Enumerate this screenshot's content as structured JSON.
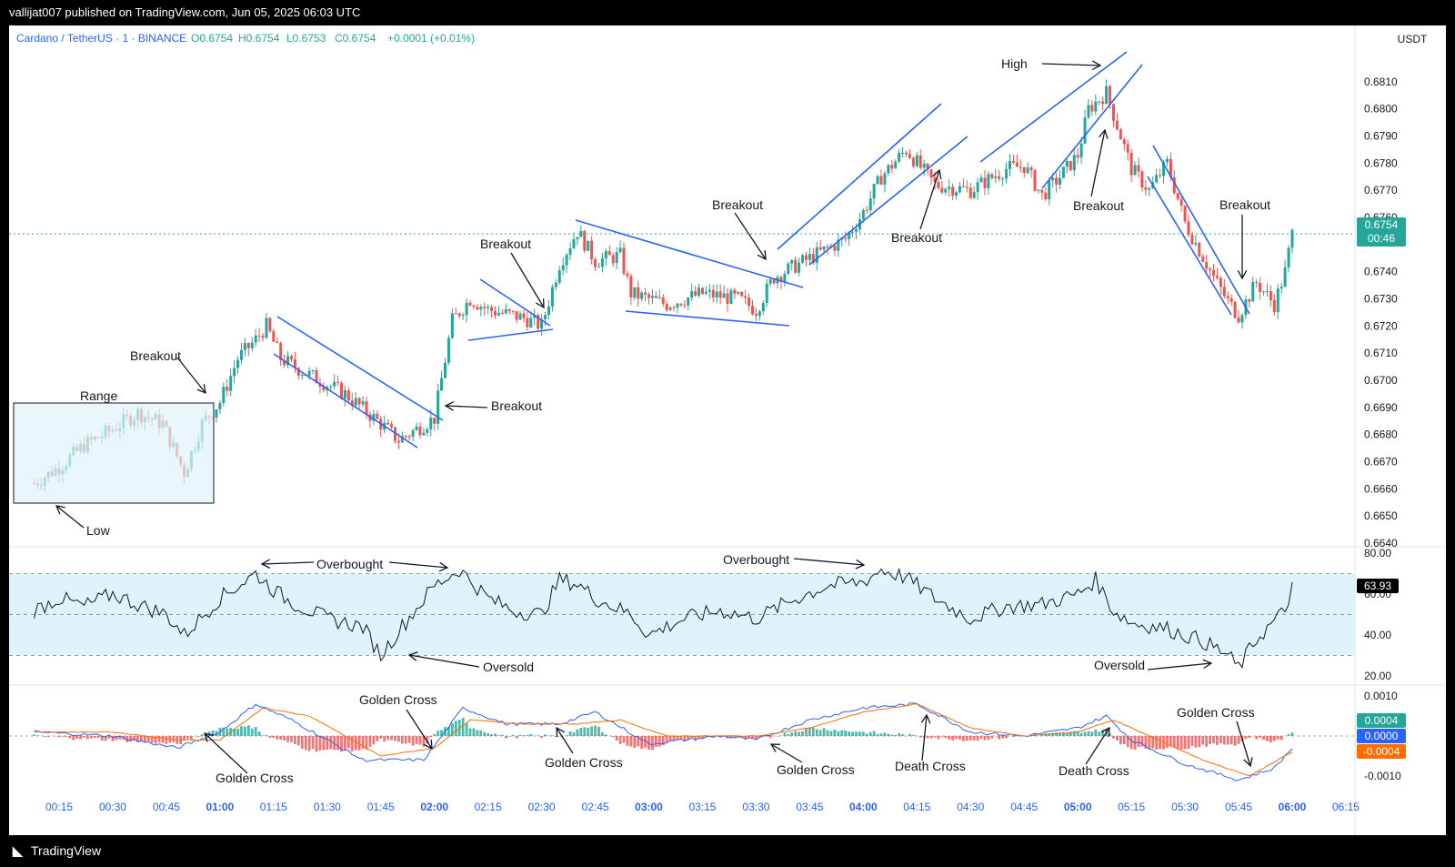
{
  "header": {
    "published": "vallijat007 published on TradingView.com, Jun 05, 2025 06:03 UTC"
  },
  "footer": {
    "brand": "TradingView"
  },
  "chart": {
    "symbol_line": "Cardano / TetherUS · 1 · BINANCE",
    "ohlc": {
      "o": "O0.6754",
      "h": "H0.6754",
      "l": "L0.6753",
      "c": "C0.6754",
      "chg": "+0.0001 (+0.01%)"
    },
    "currency": "USDT",
    "last_price_label": "0.6754",
    "countdown": "00:46",
    "rsi_value_label": "63.93",
    "macd_labels": {
      "hist": "0.0004",
      "macd": "0.0000",
      "signal": "-0.0004"
    },
    "colors": {
      "up": "#26a69a",
      "down": "#ef5350",
      "trend": "#2962ff",
      "macd": "#2962ff",
      "signal": "#ff6d00",
      "rsi_band": "#e0f3fa"
    }
  },
  "annotations": {
    "range": "Range",
    "low": "Low",
    "breakout_1": "Breakout",
    "breakout_2": "Breakout",
    "breakout_3": "Breakout",
    "breakout_4": "Breakout",
    "breakout_5": "Breakout",
    "breakout_6": "Breakout",
    "breakout_7": "Breakout",
    "high": "High",
    "overbought_1": "Overbought",
    "overbought_2": "Overbought",
    "oversold_1": "Oversold",
    "oversold_2": "Oversold",
    "golden_1": "Golden Cross",
    "golden_2": "Golden Cross",
    "golden_3": "Golden Cross",
    "golden_4": "Golden Cross",
    "golden_5": "Golden Cross",
    "death_1": "Death Cross",
    "death_2": "Death Cross"
  },
  "chart_data": [
    {
      "type": "candlestick",
      "title": "Cardano / TetherUS · 1 · BINANCE",
      "x": [
        "00:15",
        "00:30",
        "00:45",
        "01:00",
        "01:15",
        "01:30",
        "01:45",
        "02:00",
        "02:15",
        "02:30",
        "02:45",
        "03:00",
        "03:15",
        "03:30",
        "03:45",
        "04:00",
        "04:15",
        "04:30",
        "04:45",
        "05:00",
        "05:15",
        "05:30",
        "05:45",
        "06:00",
        "06:15"
      ],
      "ylim": [
        0.664,
        0.6815
      ],
      "y_ticks": [
        "0.6810",
        "0.6800",
        "0.6790",
        "0.6780",
        "0.6770",
        "0.6760",
        "0.6740",
        "0.6730",
        "0.6720",
        "0.6710",
        "0.6700",
        "0.6690",
        "0.6680",
        "0.6670",
        "0.6660",
        "0.6650",
        "0.6640"
      ],
      "series": [
        {
          "name": "close",
          "points": [
            [
              "00:08",
              0.6662
            ],
            [
              "00:15",
              0.6668
            ],
            [
              "00:22",
              0.6676
            ],
            [
              "00:30",
              0.6682
            ],
            [
              "00:37",
              0.6688
            ],
            [
              "00:44",
              0.6684
            ],
            [
              "00:50",
              0.6666
            ],
            [
              "00:55",
              0.6684
            ],
            [
              "01:00",
              0.6692
            ],
            [
              "01:05",
              0.6708
            ],
            [
              "01:10",
              0.6715
            ],
            [
              "01:13",
              0.672
            ],
            [
              "01:17",
              0.6708
            ],
            [
              "01:25",
              0.6702
            ],
            [
              "01:35",
              0.6695
            ],
            [
              "01:45",
              0.6684
            ],
            [
              "01:50",
              0.6678
            ],
            [
              "02:00",
              0.6686
            ],
            [
              "02:05",
              0.6722
            ],
            [
              "02:10",
              0.673
            ],
            [
              "02:15",
              0.6726
            ],
            [
              "02:25",
              0.6723
            ],
            [
              "02:30",
              0.672
            ],
            [
              "02:35",
              0.6743
            ],
            [
              "02:40",
              0.6755
            ],
            [
              "02:45",
              0.6744
            ],
            [
              "02:52",
              0.6746
            ],
            [
              "02:55",
              0.6732
            ],
            [
              "03:05",
              0.6728
            ],
            [
              "03:15",
              0.6732
            ],
            [
              "03:25",
              0.673
            ],
            [
              "03:30",
              0.6726
            ],
            [
              "03:35",
              0.6738
            ],
            [
              "03:45",
              0.6745
            ],
            [
              "03:55",
              0.6752
            ],
            [
              "04:00",
              0.6762
            ],
            [
              "04:05",
              0.6775
            ],
            [
              "04:12",
              0.6785
            ],
            [
              "04:20",
              0.6772
            ],
            [
              "04:30",
              0.677
            ],
            [
              "04:40",
              0.6778
            ],
            [
              "04:45",
              0.6779
            ],
            [
              "04:50",
              0.6768
            ],
            [
              "04:55",
              0.6775
            ],
            [
              "05:00",
              0.6783
            ],
            [
              "05:03",
              0.68
            ],
            [
              "05:08",
              0.6806
            ],
            [
              "05:12",
              0.679
            ],
            [
              "05:15",
              0.6778
            ],
            [
              "05:20",
              0.677
            ],
            [
              "05:25",
              0.678
            ],
            [
              "05:30",
              0.6758
            ],
            [
              "05:38",
              0.6738
            ],
            [
              "05:42",
              0.6729
            ],
            [
              "05:45",
              0.6724
            ],
            [
              "05:50",
              0.6736
            ],
            [
              "05:55",
              0.6728
            ],
            [
              "05:58",
              0.674
            ],
            [
              "06:00",
              0.6754
            ]
          ]
        }
      ]
    },
    {
      "type": "line",
      "title": "RSI",
      "ylim": [
        20,
        80
      ],
      "y_ticks": [
        80,
        60,
        40,
        20
      ],
      "bands": [
        30,
        50,
        70
      ],
      "series": [
        {
          "name": "RSI",
          "points": [
            [
              "00:08",
              52
            ],
            [
              "00:15",
              58
            ],
            [
              "00:22",
              54
            ],
            [
              "00:30",
              60
            ],
            [
              "00:37",
              55
            ],
            [
              "00:45",
              50
            ],
            [
              "00:50",
              40
            ],
            [
              "01:00",
              58
            ],
            [
              "01:10",
              70
            ],
            [
              "01:15",
              62
            ],
            [
              "01:20",
              56
            ],
            [
              "01:30",
              48
            ],
            [
              "01:40",
              44
            ],
            [
              "01:45",
              30
            ],
            [
              "01:50",
              42
            ],
            [
              "02:00",
              64
            ],
            [
              "02:07",
              72
            ],
            [
              "02:15",
              58
            ],
            [
              "02:22",
              52
            ],
            [
              "02:30",
              50
            ],
            [
              "02:35",
              67
            ],
            [
              "02:40",
              65
            ],
            [
              "02:45",
              58
            ],
            [
              "02:55",
              50
            ],
            [
              "03:00",
              40
            ],
            [
              "03:10",
              48
            ],
            [
              "03:20",
              52
            ],
            [
              "03:30",
              48
            ],
            [
              "03:40",
              57
            ],
            [
              "03:50",
              64
            ],
            [
              "04:00",
              66
            ],
            [
              "04:05",
              72
            ],
            [
              "04:12",
              68
            ],
            [
              "04:20",
              58
            ],
            [
              "04:30",
              48
            ],
            [
              "04:40",
              54
            ],
            [
              "04:50",
              55
            ],
            [
              "05:00",
              60
            ],
            [
              "05:05",
              67
            ],
            [
              "05:10",
              52
            ],
            [
              "05:15",
              46
            ],
            [
              "05:25",
              43
            ],
            [
              "05:35",
              37
            ],
            [
              "05:42",
              30
            ],
            [
              "05:45",
              24
            ],
            [
              "05:50",
              38
            ],
            [
              "05:58",
              52
            ],
            [
              "06:00",
              64
            ]
          ]
        }
      ]
    },
    {
      "type": "line",
      "title": "MACD",
      "ylim": [
        -0.0012,
        0.0012
      ],
      "y_ticks": [
        0.001,
        -0.001
      ],
      "series": [
        {
          "name": "MACD",
          "points": [
            [
              "00:08",
              0.0001
            ],
            [
              "00:30",
              0.0
            ],
            [
              "00:48",
              -0.0003
            ],
            [
              "01:00",
              0.0001
            ],
            [
              "01:10",
              0.0008
            ],
            [
              "01:20",
              0.0004
            ],
            [
              "01:40",
              -0.0006
            ],
            [
              "01:57",
              -0.0006
            ],
            [
              "02:08",
              0.0007
            ],
            [
              "02:20",
              0.0003
            ],
            [
              "02:35",
              0.0003
            ],
            [
              "02:45",
              0.0006
            ],
            [
              "03:00",
              -0.0002
            ],
            [
              "03:20",
              0.0
            ],
            [
              "03:30",
              -0.0001
            ],
            [
              "03:45",
              0.0004
            ],
            [
              "04:00",
              0.0007
            ],
            [
              "04:15",
              0.0008
            ],
            [
              "04:30",
              0.0001
            ],
            [
              "04:45",
              0.0
            ],
            [
              "05:00",
              0.0002
            ],
            [
              "05:08",
              0.0005
            ],
            [
              "05:15",
              -0.0001
            ],
            [
              "05:30",
              -0.0007
            ],
            [
              "05:45",
              -0.0011
            ],
            [
              "05:55",
              -0.0008
            ],
            [
              "06:00",
              -0.0003
            ]
          ]
        },
        {
          "name": "Signal",
          "points": [
            [
              "00:08",
              0.0001
            ],
            [
              "00:30",
              0.0001
            ],
            [
              "00:48",
              -0.0001
            ],
            [
              "01:00",
              -0.0001
            ],
            [
              "01:12",
              0.0007
            ],
            [
              "01:25",
              0.0005
            ],
            [
              "01:45",
              -0.0005
            ],
            [
              "02:00",
              -0.0003
            ],
            [
              "02:10",
              0.0004
            ],
            [
              "02:25",
              0.0003
            ],
            [
              "02:40",
              0.0003
            ],
            [
              "02:52",
              0.0004
            ],
            [
              "03:05",
              0.0
            ],
            [
              "03:30",
              0.0
            ],
            [
              "03:45",
              0.0002
            ],
            [
              "04:00",
              0.0006
            ],
            [
              "04:15",
              0.0008
            ],
            [
              "04:30",
              0.0002
            ],
            [
              "04:45",
              0.0
            ],
            [
              "05:00",
              0.0001
            ],
            [
              "05:10",
              0.0004
            ],
            [
              "05:20",
              0.0
            ],
            [
              "05:35",
              -0.0006
            ],
            [
              "05:48",
              -0.001
            ],
            [
              "06:00",
              -0.0004
            ]
          ]
        }
      ]
    }
  ]
}
